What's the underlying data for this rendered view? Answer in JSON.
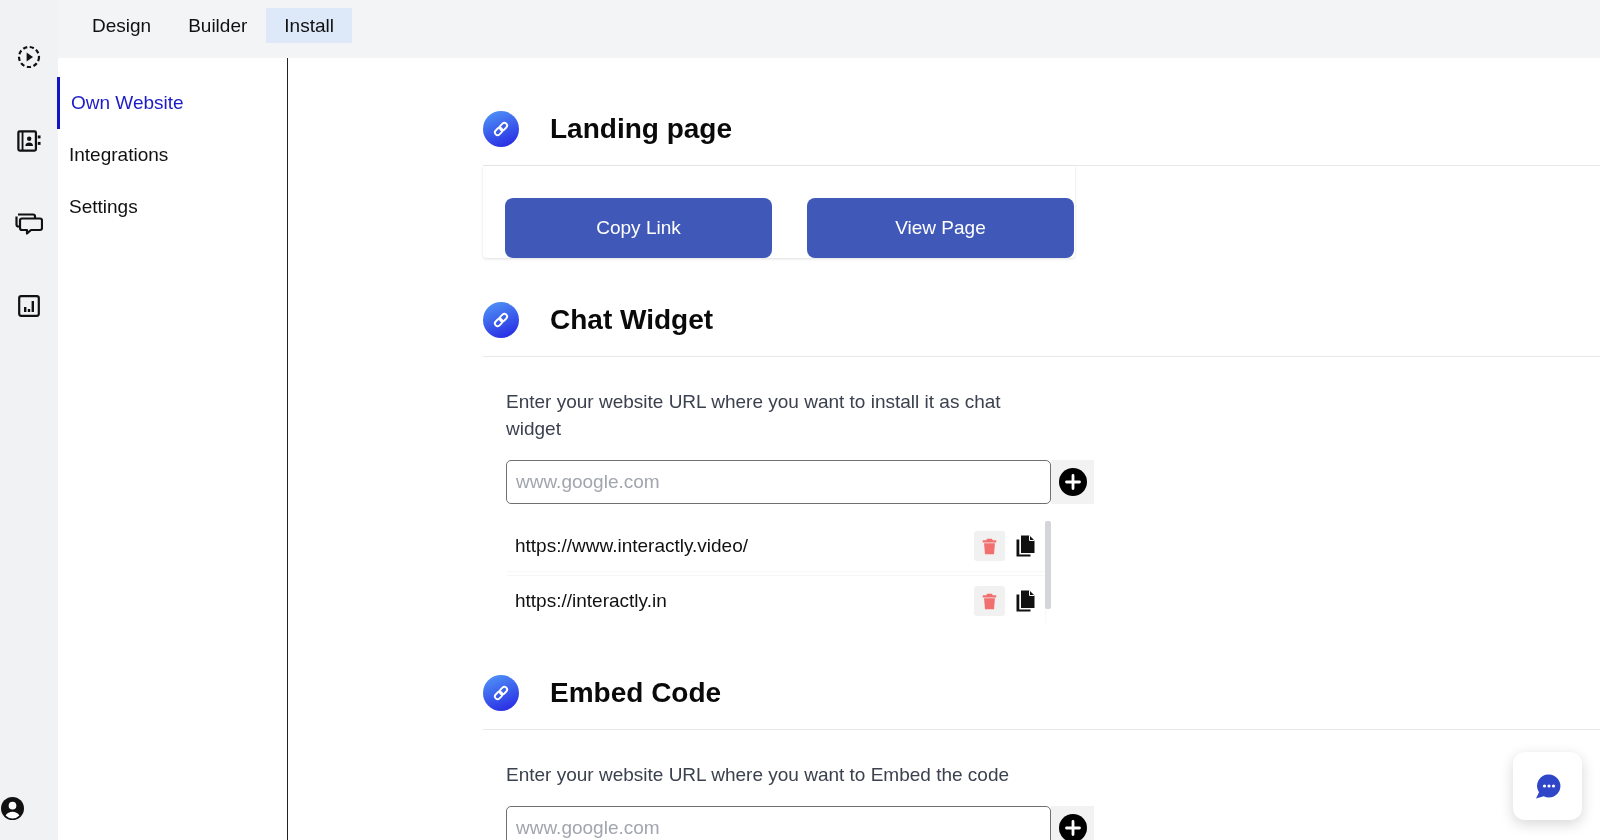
{
  "tabs": [
    {
      "label": "Design",
      "selected": false
    },
    {
      "label": "Builder",
      "selected": false
    },
    {
      "label": "Install",
      "selected": true
    }
  ],
  "sidebar": {
    "items": [
      {
        "label": "Own Website",
        "selected": true
      },
      {
        "label": "Integrations",
        "selected": false
      },
      {
        "label": "Settings",
        "selected": false
      }
    ]
  },
  "sections": [
    {
      "kind": "buttons",
      "title": "Landing page",
      "buttons": [
        "Copy Link",
        "View Page"
      ]
    },
    {
      "kind": "url_list",
      "title": "Chat Widget",
      "description": "Enter your website URL where you want to install it as chat widget",
      "input": {
        "placeholder": "www.google.com"
      },
      "urls": [
        "https://www.interactly.video/",
        "https://interactly.in"
      ]
    },
    {
      "kind": "url_list",
      "title": "Embed Code",
      "description": "Enter your website URL where you want to Embed the code",
      "input": {
        "placeholder": "www.google.com"
      }
    }
  ]
}
